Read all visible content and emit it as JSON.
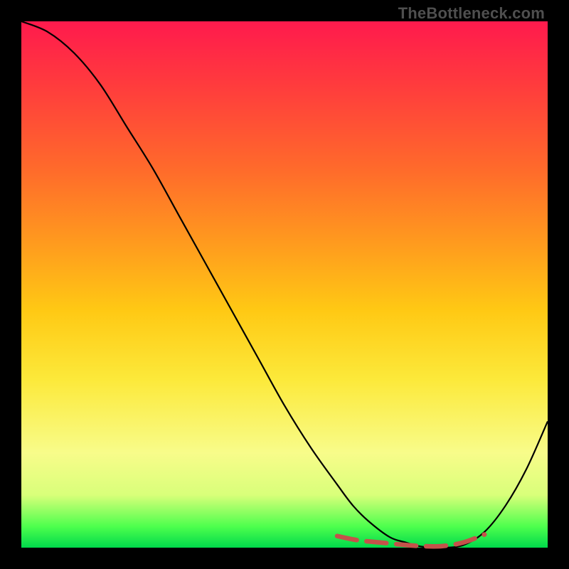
{
  "watermark": "TheBottleneck.com",
  "chart_data": {
    "type": "line",
    "title": "",
    "xlabel": "",
    "ylabel": "",
    "xlim": [
      0,
      100
    ],
    "ylim": [
      0,
      100
    ],
    "grid": false,
    "series": [
      {
        "name": "bottleneck-curve",
        "color": "#000000",
        "x": [
          0,
          5,
          10,
          15,
          20,
          25,
          30,
          35,
          40,
          45,
          50,
          55,
          60,
          63,
          66,
          70,
          73,
          76,
          80,
          84,
          88,
          92,
          96,
          100
        ],
        "y": [
          100,
          98,
          94,
          88,
          80,
          72,
          63,
          54,
          45,
          36,
          27,
          19,
          12,
          8,
          5,
          2,
          1,
          0.2,
          0,
          0.5,
          3,
          8,
          15,
          24
        ]
      },
      {
        "name": "optimal-range-marker",
        "color": "#c4524a",
        "style": "dashed",
        "x": [
          60,
          64,
          68,
          72,
          76,
          80,
          84,
          88
        ],
        "y": [
          2.2,
          1.4,
          1.0,
          0.6,
          0.3,
          0.3,
          1.0,
          2.5
        ]
      }
    ],
    "background_gradient": {
      "direction": "vertical",
      "stops": [
        {
          "pos": 0.0,
          "color": "#ff1a4d"
        },
        {
          "pos": 0.28,
          "color": "#ff6a2b"
        },
        {
          "pos": 0.55,
          "color": "#ffc914"
        },
        {
          "pos": 0.82,
          "color": "#f8fc8a"
        },
        {
          "pos": 1.0,
          "color": "#00d94b"
        }
      ]
    }
  }
}
